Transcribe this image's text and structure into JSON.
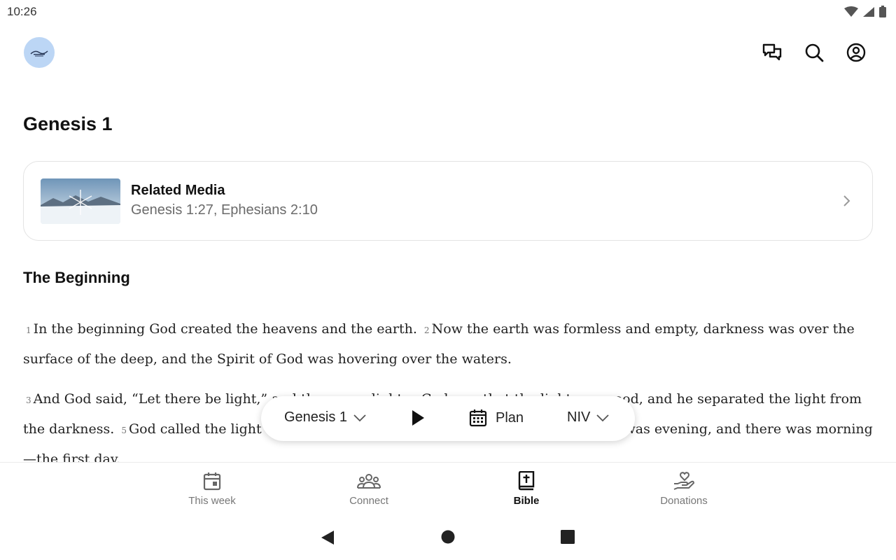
{
  "status_bar": {
    "time": "10:26"
  },
  "header": {
    "logo": "church-logo",
    "actions": [
      {
        "name": "chat-icon"
      },
      {
        "name": "search-icon"
      },
      {
        "name": "account-icon"
      }
    ]
  },
  "page": {
    "title": "Genesis 1"
  },
  "related_media": {
    "title": "Related Media",
    "subtitle": "Genesis 1:27, Ephesians 2:10",
    "thumbnail": "snowflake-landscape-image"
  },
  "section": {
    "heading": "The Beginning"
  },
  "scripture": {
    "paragraphs": [
      {
        "verses": [
          {
            "num": "1",
            "text": "In the beginning God created the heavens and the earth."
          },
          {
            "num": "2",
            "text": "Now the earth was formless and empty, darkness was over the surface of the deep, and the Spirit of God was hovering over the waters."
          }
        ]
      },
      {
        "verses": [
          {
            "num": "3",
            "text": "And God said, “Let there be light,” and there was light."
          },
          {
            "num": "4",
            "text": "God saw that the light was good, and he separated the light from the darkness."
          },
          {
            "num": "5",
            "text": "God called the light “day,” and the darkness he called “night.” And there was evening, and there was morning—the first day."
          }
        ]
      }
    ]
  },
  "toolbar": {
    "chapter": "Genesis 1",
    "plan_label": "Plan",
    "version": "NIV"
  },
  "bottom_nav": {
    "items": [
      {
        "label": "This week",
        "icon": "calendar-icon"
      },
      {
        "label": "Connect",
        "icon": "people-icon"
      },
      {
        "label": "Bible",
        "icon": "bible-icon",
        "active": true
      },
      {
        "label": "Donations",
        "icon": "donation-icon"
      }
    ]
  },
  "colors": {
    "logo_bg": "#bcd6f5",
    "text": "#1a1a1a",
    "muted": "#6b6b6b"
  }
}
